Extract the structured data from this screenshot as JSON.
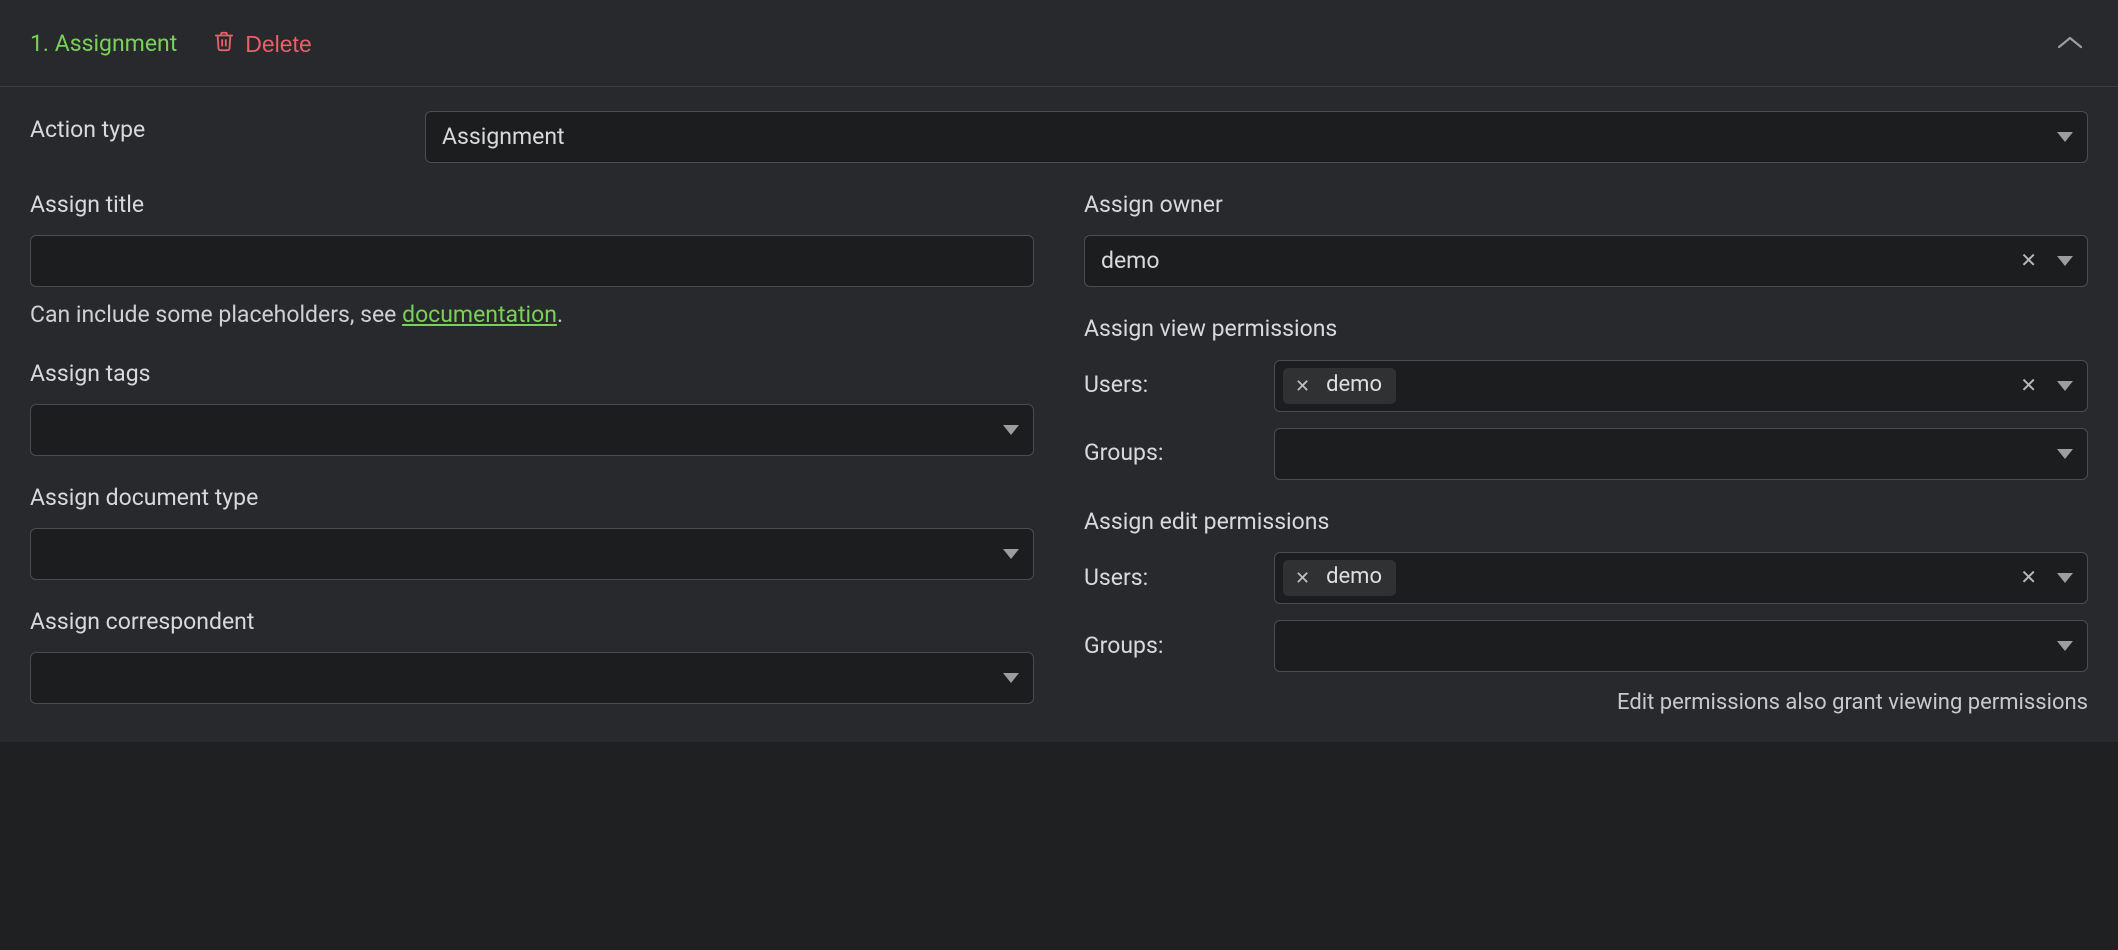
{
  "header": {
    "title": "1. Assignment",
    "delete_label": "Delete"
  },
  "action_type": {
    "label": "Action type",
    "selected": "Assignment"
  },
  "left": {
    "title": {
      "label": "Assign title",
      "value": "",
      "help_prefix": "Can include some placeholders, see ",
      "help_link": "documentation",
      "help_suffix": "."
    },
    "tags": {
      "label": "Assign tags"
    },
    "doctype": {
      "label": "Assign document type"
    },
    "correspondent": {
      "label": "Assign correspondent"
    }
  },
  "right": {
    "owner": {
      "label": "Assign owner",
      "selected": "demo"
    },
    "view_perms": {
      "label": "Assign view permissions",
      "users_label": "Users:",
      "users_selected": [
        "demo"
      ],
      "groups_label": "Groups:"
    },
    "edit_perms": {
      "label": "Assign edit permissions",
      "users_label": "Users:",
      "users_selected": [
        "demo"
      ],
      "groups_label": "Groups:",
      "note": "Edit permissions also grant viewing permissions"
    }
  }
}
